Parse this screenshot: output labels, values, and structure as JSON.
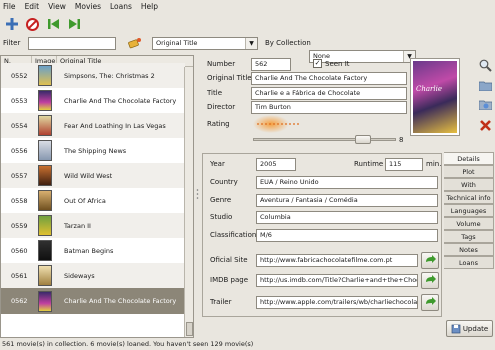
{
  "menu": [
    "File",
    "Edit",
    "View",
    "Movies",
    "Loans",
    "Help"
  ],
  "filter": {
    "label": "Filter",
    "value": "",
    "field": "Original Title",
    "by_collection_label": "By Collection",
    "collection": "None"
  },
  "list": {
    "columns": [
      "N.",
      "Image",
      "Original Title"
    ],
    "rows": [
      {
        "n": "0552",
        "title": "Simpsons, The: Christmas 2"
      },
      {
        "n": "0553",
        "title": "Charlie And The Chocolate Factory"
      },
      {
        "n": "0554",
        "title": "Fear And Loathing In Las Vegas"
      },
      {
        "n": "0556",
        "title": "The Shipping News"
      },
      {
        "n": "0557",
        "title": "Wild Wild West"
      },
      {
        "n": "0558",
        "title": "Out Of Africa"
      },
      {
        "n": "0559",
        "title": "Tarzan II"
      },
      {
        "n": "0560",
        "title": "Batman Begins"
      },
      {
        "n": "0561",
        "title": "Sideways"
      },
      {
        "n": "0562",
        "title": "Charlie And The Chocolate Factory"
      }
    ],
    "selected_index": 9
  },
  "detail": {
    "number_label": "Number",
    "number": "562",
    "seen_label": "Seen It",
    "seen": true,
    "original_title_label": "Original Title",
    "original_title": "Charlie And The Chocolate Factory",
    "title_label": "Title",
    "title": "Charlie e a Fábrica de Chocolate",
    "director_label": "Director",
    "director": "Tim Burton",
    "rating_label": "Rating",
    "rating": "8",
    "poster_text": "Charlie"
  },
  "details": {
    "year_label": "Year",
    "year": "2005",
    "runtime_label": "Runtime",
    "runtime": "115",
    "runtime_unit": "min.",
    "country_label": "Country",
    "country": "EUA / Reino Unido",
    "genre_label": "Genre",
    "genre": "Aventura / Fantasia / Comédia",
    "studio_label": "Studio",
    "studio": "Columbia",
    "classification_label": "Classification",
    "classification": "M/6",
    "site_label": "Oficial Site",
    "site": "http://www.fabricachocolatefilme.com.pt",
    "imdb_label": "IMDB page",
    "imdb": "http://us.imdb.com/Title?Charlie+and+the+Chocolat",
    "trailer_label": "Trailer",
    "trailer": "http://www.apple.com/trailers/wb/charliechocolat"
  },
  "tabs": [
    "Details",
    "Plot",
    "With",
    "Technical info",
    "Languages",
    "Volume",
    "Tags",
    "Notes",
    "Loans"
  ],
  "update_label": "Update",
  "status": "561 movie(s) in collection. 6 movie(s) loaned. You haven't seen 129 movie(s)",
  "colors": {
    "selection": "#8c8678",
    "accent_green": "#3f9a2d"
  }
}
